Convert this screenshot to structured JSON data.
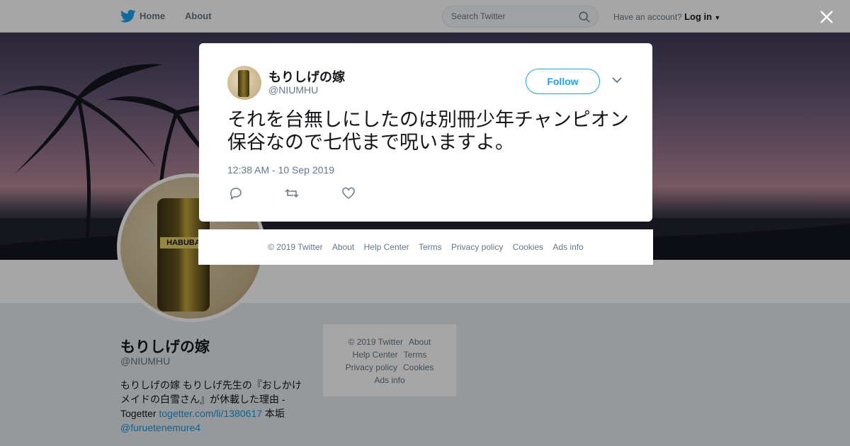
{
  "topbar": {
    "home_label": "Home",
    "about_label": "About",
    "search_placeholder": "Search Twitter",
    "account_prompt": "Have an account?",
    "login_label": "Log in"
  },
  "profile": {
    "name": "もりしげの嫁",
    "handle": "@NIUMHU",
    "bio_text": "もりしげの嫁 もりしげ先生の『おしかけメイドの白雪さん』が休載した理由 - Togetter",
    "bio_link": "togetter.com/li/1380617",
    "bio_tail": "本垢",
    "bio_mention": "@furuetenemure4",
    "avatar_can_label": "HABUBA"
  },
  "profile_footer": {
    "copyright": "© 2019 Twitter",
    "about": "About",
    "help": "Help Center",
    "terms": "Terms",
    "privacy": "Privacy policy",
    "cookies": "Cookies",
    "ads": "Ads info"
  },
  "tweet": {
    "name": "もりしげの嫁",
    "handle": "@NIUMHU",
    "follow_label": "Follow",
    "text": "それを台無しにしたのは別冊少年チャンピオン保谷なので七代まで呪いますよ。",
    "timestamp": "12:38 AM - 10 Sep 2019"
  },
  "modal_footer": {
    "copyright": "© 2019 Twitter",
    "about": "About",
    "help": "Help Center",
    "terms": "Terms",
    "privacy": "Privacy policy",
    "cookies": "Cookies",
    "ads": "Ads info"
  },
  "colors": {
    "accent": "#1da1f2",
    "link": "#1b95e0",
    "muted": "#657786"
  }
}
